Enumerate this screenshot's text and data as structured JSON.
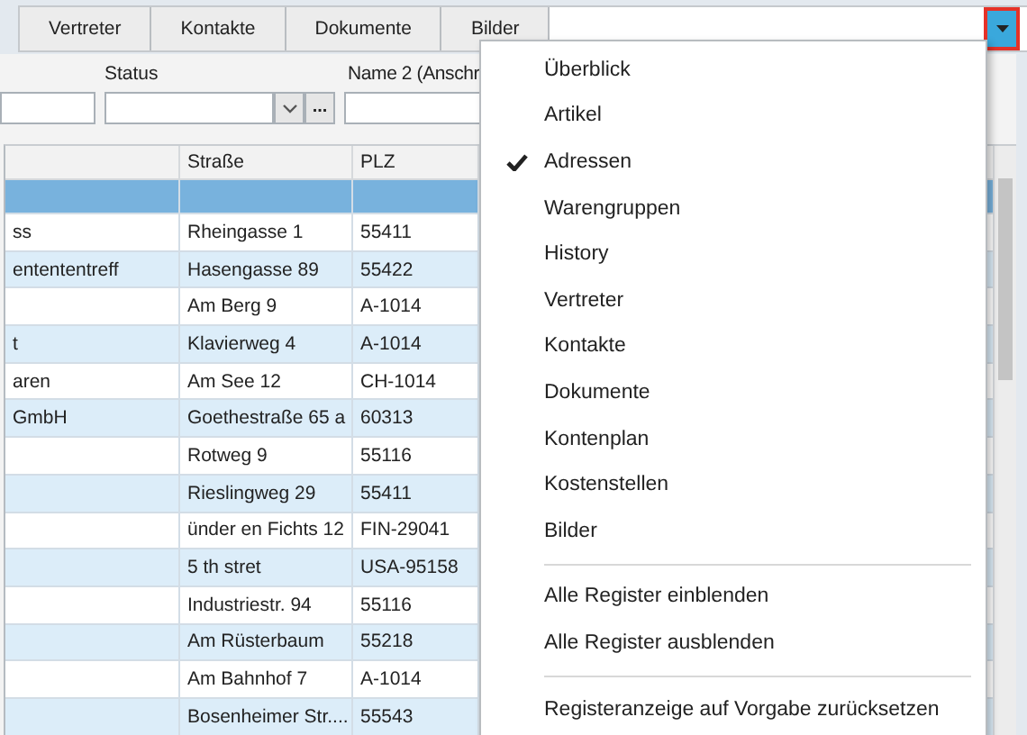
{
  "tabs": [
    {
      "label": "Vertreter"
    },
    {
      "label": "Kontakte"
    },
    {
      "label": "Dokumente"
    },
    {
      "label": "Bilder"
    }
  ],
  "tab_menu_button": {
    "highlighted": true
  },
  "filters": [
    {
      "kind": "text"
    },
    {
      "kind": "combo",
      "label": "Status",
      "more": "..."
    },
    {
      "kind": "text",
      "label": "Name 2 (Anschr"
    }
  ],
  "table": {
    "columns": [
      {
        "label": "Straße"
      },
      {
        "label": "PLZ"
      }
    ],
    "rows": [
      {
        "selected": true
      },
      {
        "selected": false,
        "column_1": "ss",
        "street": "Rheingasse 1",
        "plz": "55411"
      },
      {
        "selected": false,
        "column_1": "entententreff",
        "street": "Hasengasse 89",
        "plz": "55422"
      },
      {
        "selected": false,
        "street": "Am Berg 9",
        "plz": "A-1014"
      },
      {
        "selected": false,
        "column_1": "t",
        "street": "Klavierweg 4",
        "plz": "A-1014"
      },
      {
        "selected": false,
        "column_1": "aren",
        "street": "Am See 12",
        "plz": "CH-1014"
      },
      {
        "selected": false,
        "column_1": "GmbH",
        "street": "Goethestraße 65 a",
        "plz": "60313"
      },
      {
        "selected": false,
        "street": "Rotweg 9",
        "plz": "55116"
      },
      {
        "selected": false,
        "street": "Rieslingweg 29",
        "plz": "55411"
      },
      {
        "selected": false,
        "street": "ünder en Fichts 12",
        "plz": "FIN-29041"
      },
      {
        "selected": false,
        "street": "5 th stret",
        "plz": "USA-95158"
      },
      {
        "selected": false,
        "street": "Industriestr. 94",
        "plz": "55116"
      },
      {
        "selected": false,
        "street": "Am Rüsterbaum",
        "plz": "55218"
      },
      {
        "selected": false,
        "street": "Am Bahnhof 7",
        "plz": "A-1014"
      },
      {
        "selected": false,
        "street": "Bosenheimer Str....",
        "plz": "55543"
      }
    ]
  },
  "menu": {
    "items": [
      {
        "kind": "option",
        "label": "Überblick",
        "checked": false
      },
      {
        "kind": "option",
        "label": "Artikel",
        "checked": false
      },
      {
        "kind": "option",
        "label": "Adressen",
        "checked": true
      },
      {
        "kind": "option",
        "label": "Warengruppen",
        "checked": false
      },
      {
        "kind": "option",
        "label": "History",
        "checked": false
      },
      {
        "kind": "option",
        "label": "Vertreter",
        "checked": false
      },
      {
        "kind": "option",
        "label": "Kontakte",
        "checked": false
      },
      {
        "kind": "option",
        "label": "Dokumente",
        "checked": false
      },
      {
        "kind": "option",
        "label": "Kontenplan",
        "checked": false
      },
      {
        "kind": "option",
        "label": "Kostenstellen",
        "checked": false
      },
      {
        "kind": "option",
        "label": "Bilder",
        "checked": false
      },
      {
        "kind": "separator"
      },
      {
        "kind": "action",
        "label": "Alle Register einblenden"
      },
      {
        "kind": "action",
        "label": "Alle Register ausblenden"
      },
      {
        "kind": "separator"
      },
      {
        "kind": "action",
        "label": "Registeranzeige auf Vorgabe zurücksetzen"
      }
    ]
  }
}
